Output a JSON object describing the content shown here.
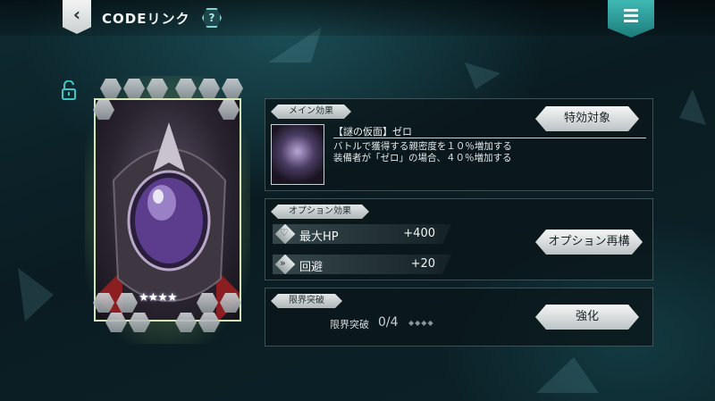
{
  "header": {
    "title": "CODEリンク",
    "back_icon": "‹",
    "help_icon": "?",
    "menu_icon": "menu-icon"
  },
  "card": {
    "rarity": "★★★★",
    "locked": false
  },
  "main_effect": {
    "label": "メイン効果",
    "skill_name": "【謎の仮面】ゼロ",
    "description_line1": "バトルで獲得する親密度を１０％増加する",
    "description_line2": "装備者が「ゼロ」の場合、４０％増加する",
    "button": "特効対象"
  },
  "option_effect": {
    "label": "オプション効果",
    "options": [
      {
        "icon": "heart-icon",
        "name": "最大HP",
        "value": "+400"
      },
      {
        "icon": "dodge-icon",
        "name": "回避",
        "value": "+20"
      }
    ],
    "button": "オプション再構"
  },
  "limit_break": {
    "label": "限界突破",
    "text": "限界突破",
    "count": "0/4",
    "pips": "◆◆◆◆",
    "button": "強化"
  },
  "colors": {
    "accent": "#3fb9b4",
    "background": "#0e2a31",
    "card_glow": "#e6ff8c"
  }
}
